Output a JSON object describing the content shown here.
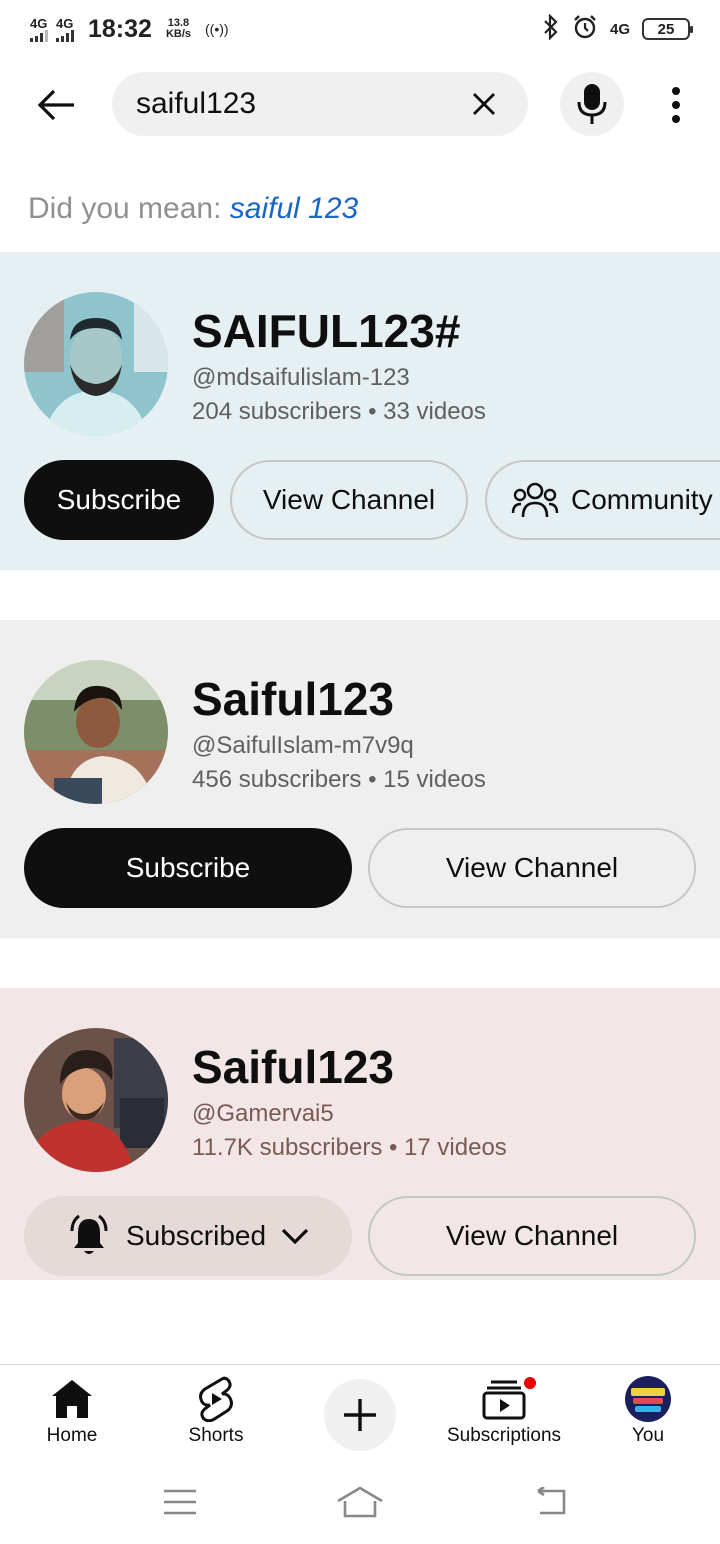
{
  "status_bar": {
    "sim1": "4G",
    "sim2": "4G",
    "time": "18:32",
    "speed_value": "13.8",
    "speed_unit": "KB/s",
    "hotspot": "((•))",
    "net": "4G",
    "battery": "25"
  },
  "search": {
    "query": "saiful123"
  },
  "suggestion": {
    "prefix": "Did you mean:",
    "text": "saiful 123"
  },
  "channels": [
    {
      "title": "SAIFUL123#",
      "handle": "@mdsaifulislam-123",
      "meta": "204 subscribers • 33 videos",
      "subscribe_label": "Subscribe",
      "view_label": "View Channel",
      "community_label": "Community"
    },
    {
      "title": "Saiful123",
      "handle": "@SaifulIslam-m7v9q",
      "meta": "456 subscribers • 15 videos",
      "subscribe_label": "Subscribe",
      "view_label": "View Channel"
    },
    {
      "title": "Saiful123",
      "handle": "@Gamervai5",
      "meta": "11.7K subscribers • 17 videos",
      "subscribed_label": "Subscribed",
      "view_label": "View Channel"
    }
  ],
  "bottom_nav": {
    "home": "Home",
    "shorts": "Shorts",
    "subscriptions": "Subscriptions",
    "you": "You"
  },
  "colors": {
    "card1_bg": "#e6eff2",
    "card2_bg": "#efefef",
    "card3_bg": "#f2e6e6",
    "link": "#1a66c8",
    "notification": "#e00000"
  }
}
